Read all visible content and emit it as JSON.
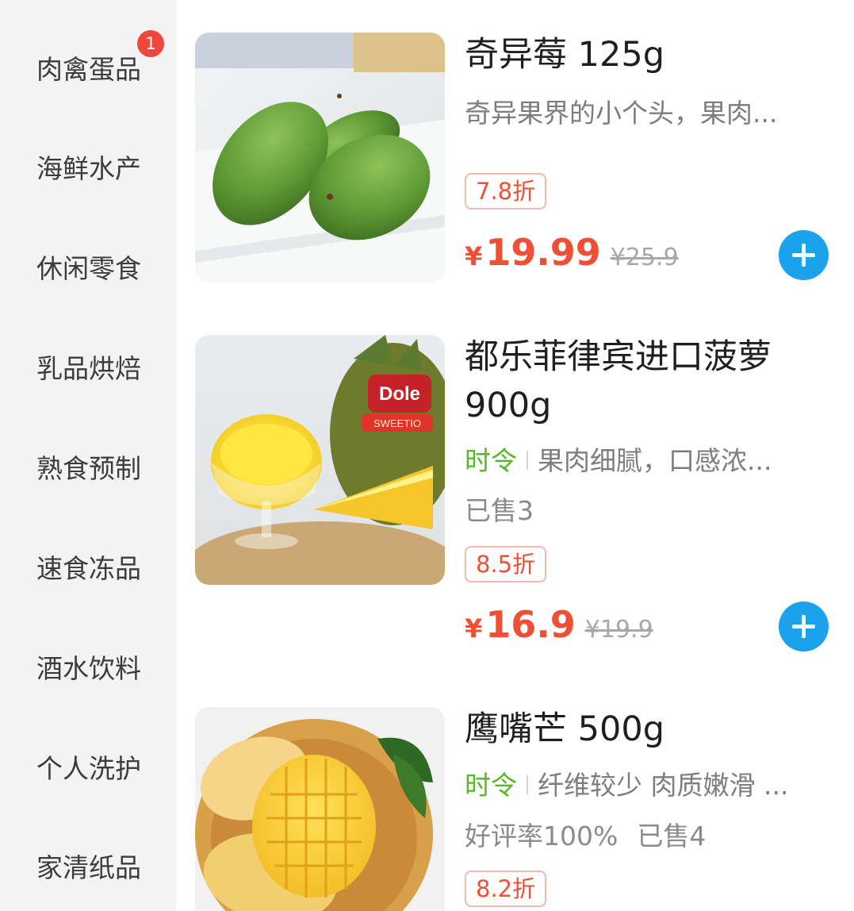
{
  "sidebar": {
    "categories": [
      {
        "label": "肉禽蛋品",
        "badge": "1"
      },
      {
        "label": "海鲜水产"
      },
      {
        "label": "休闲零食"
      },
      {
        "label": "乳品烘焙"
      },
      {
        "label": "熟食预制"
      },
      {
        "label": "速食冻品"
      },
      {
        "label": "酒水饮料"
      },
      {
        "label": "个人洗护"
      },
      {
        "label": "家清纸品"
      }
    ]
  },
  "products": [
    {
      "name": "奇异莓 125g",
      "description": "奇异果界的小个头，果肉...",
      "discount": "7.8折",
      "currency": "¥",
      "price": "19.99",
      "original_price": "¥25.9",
      "image": "kiwi-berry-photo"
    },
    {
      "name_line1": "都乐菲律宾进口菠萝",
      "name_line2": "900g",
      "season_tag": "时令",
      "description": "果肉细腻，口感浓...",
      "sold": "已售3",
      "discount": "8.5折",
      "currency": "¥",
      "price": "16.9",
      "original_price": "¥19.9",
      "image": "pineapple-photo",
      "image_text": [
        "Dole",
        "SWEETIO"
      ]
    },
    {
      "name": "鹰嘴芒 500g",
      "season_tag": "时令",
      "description": "纤维较少 肉质嫩滑 ...",
      "rating": "好评率100%",
      "sold": "已售4",
      "discount": "8.2折",
      "image": "mango-photo"
    }
  ],
  "colors": {
    "accent_price": "#ef4f34",
    "add_button": "#1aa3ea",
    "season_tag": "#5bb62a",
    "badge": "#f0463c"
  }
}
